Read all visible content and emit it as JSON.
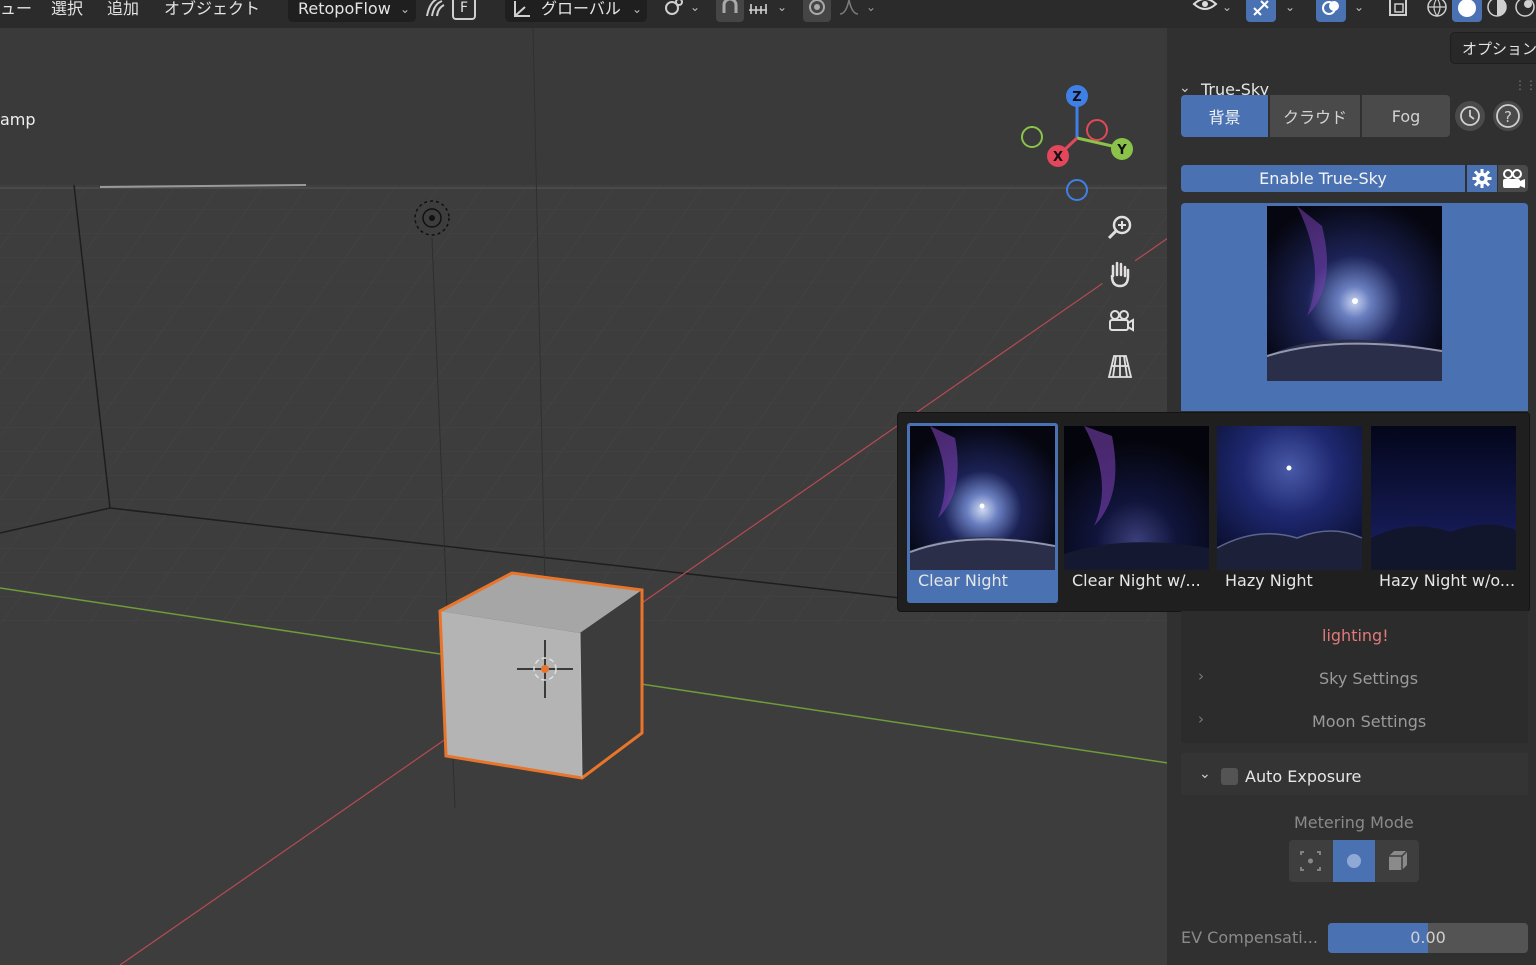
{
  "header": {
    "menu_view": "ュー",
    "menu_select": "選択",
    "menu_add": "追加",
    "menu_object": "オブジェクト",
    "addon_dropdown": "RetopoFlow",
    "addon_badge": "F",
    "transform_orientation": "グローバル"
  },
  "viewport": {
    "partial_label": "amp"
  },
  "sidebar": {
    "options_button": "オプション",
    "panel_title": "True-Sky",
    "tabs": [
      "背景",
      "クラウド",
      "Fog"
    ],
    "enable_button": "Enable True-Sky",
    "warning_text": "lighting!",
    "sky_settings": "Sky Settings",
    "moon_settings": "Moon Settings",
    "auto_exposure": "Auto Exposure",
    "metering_mode_label": "Metering Mode",
    "ev_label": "EV Compensati...",
    "ev_value": "0.00"
  },
  "preset_popup": {
    "items": [
      {
        "label": "Clear Night",
        "selected": true
      },
      {
        "label": "Clear Night w/...",
        "selected": false
      },
      {
        "label": "Hazy Night",
        "selected": false
      },
      {
        "label": "Hazy Night w/o...",
        "selected": false
      }
    ]
  },
  "colors": {
    "accent": "#4a72b2",
    "selection_outline": "#e8752a",
    "warning": "#e07a7a",
    "axis_x": "#e2475b",
    "axis_y": "#8bc34a",
    "axis_z": "#3f80e6"
  }
}
